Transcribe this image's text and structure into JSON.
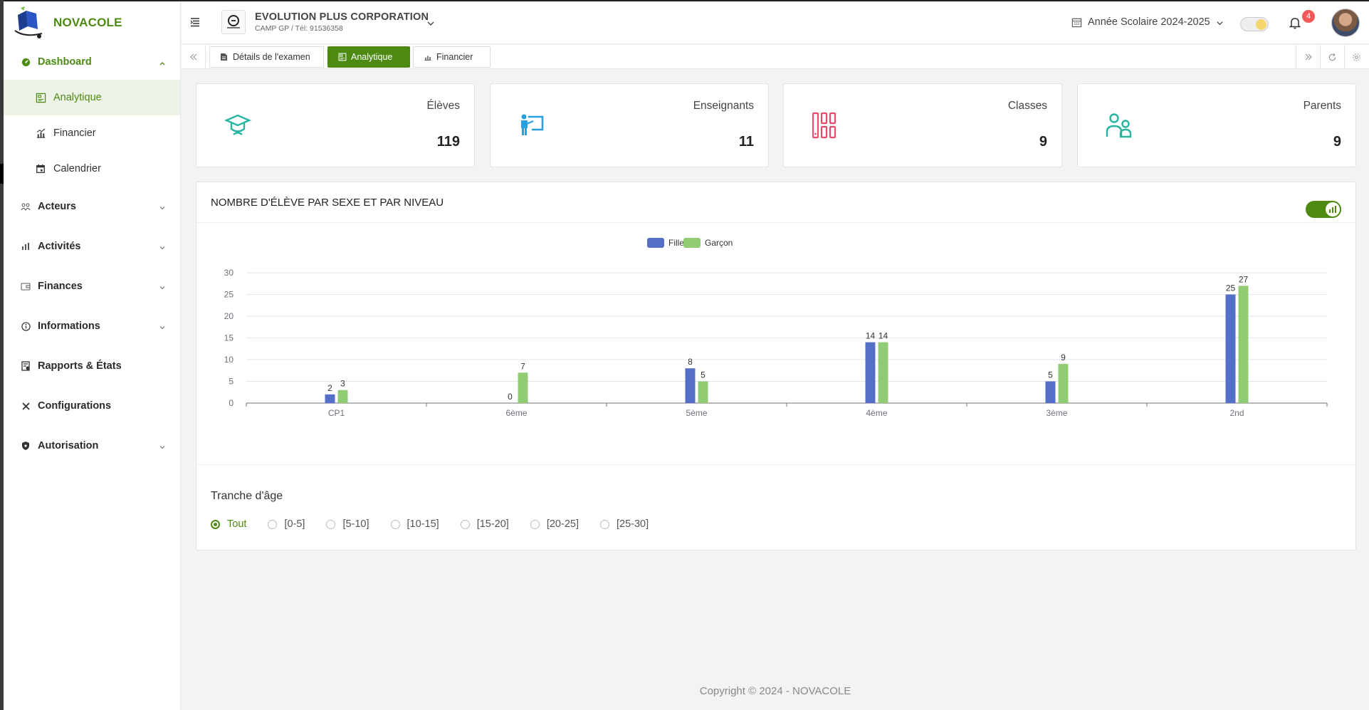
{
  "app": {
    "name": "NOVACOLE"
  },
  "sidebar": {
    "items": [
      {
        "label": "Dashboard",
        "icon": "dashboard-icon",
        "expanded": true
      },
      {
        "label": "Analytique",
        "icon": "analytics-icon"
      },
      {
        "label": "Financier",
        "icon": "finance-chart-icon"
      },
      {
        "label": "Calendrier",
        "icon": "calendar-icon"
      },
      {
        "label": "Acteurs",
        "icon": "users-icon"
      },
      {
        "label": "Activités",
        "icon": "bar-chart-icon"
      },
      {
        "label": "Finances",
        "icon": "wallet-icon"
      },
      {
        "label": "Informations",
        "icon": "info-icon"
      },
      {
        "label": "Rapports & États",
        "icon": "report-icon"
      },
      {
        "label": "Configurations",
        "icon": "tools-icon"
      },
      {
        "label": "Autorisation",
        "icon": "shield-icon"
      }
    ]
  },
  "header": {
    "company_name": "EVOLUTION PLUS CORPORATION",
    "company_sub": "CAMP GP / Tél: 91536358",
    "school_year": "Année Scolaire 2024-2025",
    "notification_count": "4"
  },
  "tabs": [
    {
      "label": "Détails de l'examen",
      "icon": "document-icon"
    },
    {
      "label": "Analytique",
      "icon": "analytics-icon",
      "active": true
    },
    {
      "label": "Financier",
      "icon": "finance-chart-icon"
    }
  ],
  "stats": [
    {
      "label": "Élèves",
      "value": "119",
      "icon": "graduate-icon",
      "color": "#26b5a0"
    },
    {
      "label": "Enseignants",
      "value": "11",
      "icon": "teacher-icon",
      "color": "#2a9fe0"
    },
    {
      "label": "Classes",
      "value": "9",
      "icon": "classes-icon",
      "color": "#e84c6b"
    },
    {
      "label": "Parents",
      "value": "9",
      "icon": "parents-icon",
      "color": "#26b5a0"
    }
  ],
  "chart_panel": {
    "title": "NOMBRE D'ÉLÈVE PAR SEXE ET PAR NIVEAU"
  },
  "chart_data": {
    "type": "bar",
    "title": "NOMBRE D'ÉLÈVE PAR SEXE ET PAR NIVEAU",
    "categories": [
      "CP1",
      "6ème",
      "5ème",
      "4ème",
      "3ème",
      "2nd"
    ],
    "series": [
      {
        "name": "Fille",
        "color": "#5470c6",
        "values": [
          2,
          0,
          8,
          14,
          5,
          25
        ]
      },
      {
        "name": "Garçon",
        "color": "#91cc75",
        "values": [
          3,
          7,
          5,
          14,
          9,
          27
        ]
      }
    ],
    "ylim": [
      0,
      30
    ],
    "yticks": [
      0,
      5,
      10,
      15,
      20,
      25,
      30
    ],
    "grid": true,
    "legend": "top-center"
  },
  "age_filter": {
    "title": "Tranche d'âge",
    "options": [
      "Tout",
      "[0-5]",
      "[5-10]",
      "[10-15]",
      "[15-20]",
      "[20-25]",
      "[25-30]"
    ],
    "selected": "Tout"
  },
  "footer": {
    "text": "Copyright © 2024 - NOVACOLE"
  }
}
